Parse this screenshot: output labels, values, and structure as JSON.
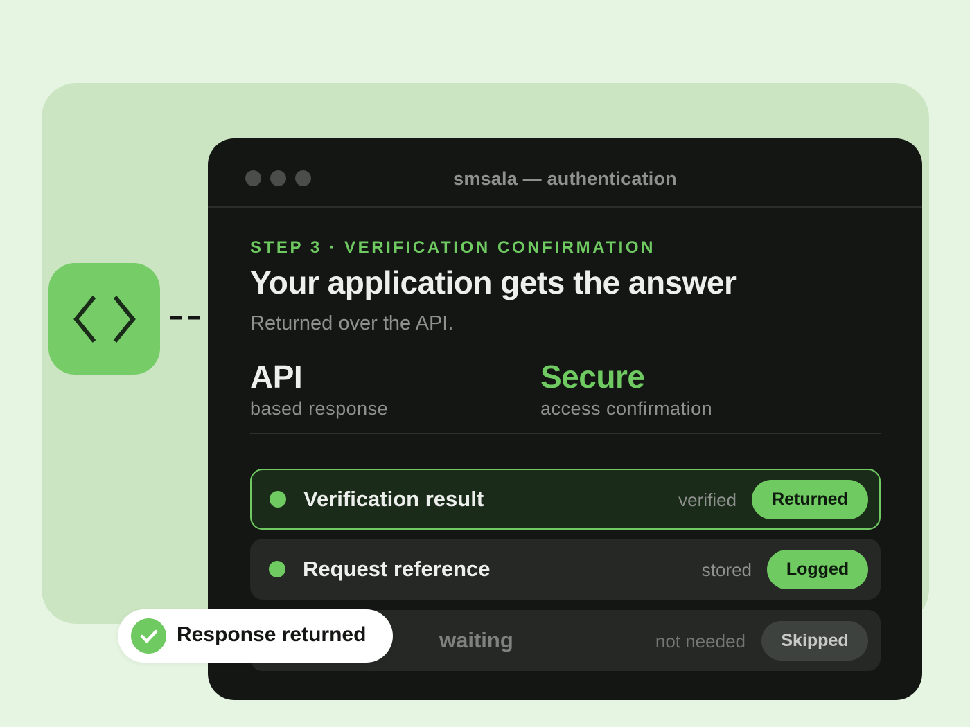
{
  "window": {
    "title": "smsala — authentication",
    "step_label": "STEP 3 · VERIFICATION CONFIRMATION",
    "headline": "Your application gets the answer",
    "subheadline": "Returned over the API."
  },
  "stats": [
    {
      "value": "API",
      "label": "based response",
      "accent": false
    },
    {
      "value": "Secure",
      "label": "access confirmation",
      "accent": true
    }
  ],
  "rows": [
    {
      "label": "Verification result",
      "status": "verified",
      "badge": "Returned",
      "state": "active"
    },
    {
      "label": "Request reference",
      "status": "stored",
      "badge": "Logged",
      "state": "done"
    },
    {
      "label": "waiting",
      "status": "not needed",
      "badge": "Skipped",
      "state": "skipped"
    }
  ],
  "toast": {
    "label": "Response returned",
    "icon": "check-icon"
  },
  "icons": {
    "tile": "code-brackets-icon",
    "window_controls": [
      "window-dot",
      "window-dot",
      "window-dot"
    ]
  },
  "colors": {
    "page_bg": "#e6f5e1",
    "panel_bg": "#cbe5c3",
    "accent": "#6fcb61",
    "window_bg": "#141614",
    "row_bg": "#252825",
    "active_row_bg": "#1b2b1a",
    "muted_text": "#8e918e",
    "skipped_badge": "#3e423e"
  }
}
